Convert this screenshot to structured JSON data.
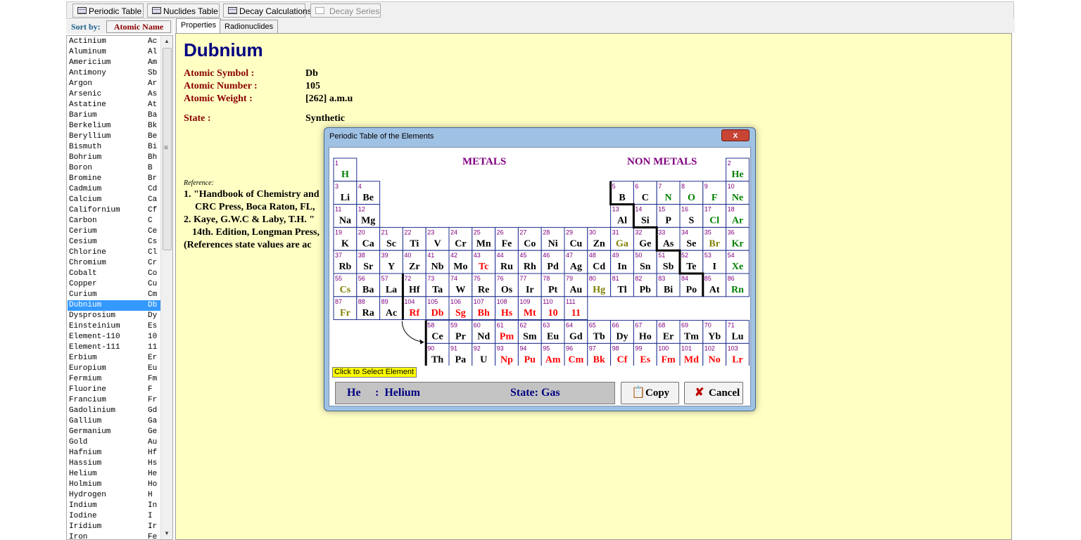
{
  "toolbar": {
    "buttons": [
      {
        "label": "Periodic Table",
        "enabled": true
      },
      {
        "label": "Nuclides Table",
        "enabled": true
      },
      {
        "label": "Decay Calculations",
        "enabled": true
      },
      {
        "label": "Decay Series",
        "enabled": false
      }
    ]
  },
  "sort": {
    "label": "Sort by:",
    "value": "Atomic Name"
  },
  "element_list": {
    "selected": "Dubnium",
    "items": [
      [
        "Actinium",
        "Ac"
      ],
      [
        "Aluminum",
        "Al"
      ],
      [
        "Americium",
        "Am"
      ],
      [
        "Antimony",
        "Sb"
      ],
      [
        "Argon",
        "Ar"
      ],
      [
        "Arsenic",
        "As"
      ],
      [
        "Astatine",
        "At"
      ],
      [
        "Barium",
        "Ba"
      ],
      [
        "Berkelium",
        "Bk"
      ],
      [
        "Beryllium",
        "Be"
      ],
      [
        "Bismuth",
        "Bi"
      ],
      [
        "Bohrium",
        "Bh"
      ],
      [
        "Boron",
        "B"
      ],
      [
        "Bromine",
        "Br"
      ],
      [
        "Cadmium",
        "Cd"
      ],
      [
        "Calcium",
        "Ca"
      ],
      [
        "Californium",
        "Cf"
      ],
      [
        "Carbon",
        "C"
      ],
      [
        "Cerium",
        "Ce"
      ],
      [
        "Cesium",
        "Cs"
      ],
      [
        "Chlorine",
        "Cl"
      ],
      [
        "Chromium",
        "Cr"
      ],
      [
        "Cobalt",
        "Co"
      ],
      [
        "Copper",
        "Cu"
      ],
      [
        "Curium",
        "Cm"
      ],
      [
        "Dubnium",
        "Db"
      ],
      [
        "Dysprosium",
        "Dy"
      ],
      [
        "Einsteinium",
        "Es"
      ],
      [
        "Element-110",
        "10"
      ],
      [
        "Element-111",
        "11"
      ],
      [
        "Erbium",
        "Er"
      ],
      [
        "Europium",
        "Eu"
      ],
      [
        "Fermium",
        "Fm"
      ],
      [
        "Fluorine",
        "F"
      ],
      [
        "Francium",
        "Fr"
      ],
      [
        "Gadolinium",
        "Gd"
      ],
      [
        "Gallium",
        "Ga"
      ],
      [
        "Germanium",
        "Ge"
      ],
      [
        "Gold",
        "Au"
      ],
      [
        "Hafnium",
        "Hf"
      ],
      [
        "Hassium",
        "Hs"
      ],
      [
        "Helium",
        "He"
      ],
      [
        "Holmium",
        "Ho"
      ],
      [
        "Hydrogen",
        "H"
      ],
      [
        "Indium",
        "In"
      ],
      [
        "Iodine",
        "I"
      ],
      [
        "Iridium",
        "Ir"
      ],
      [
        "Iron",
        "Fe"
      ]
    ]
  },
  "tabs": [
    {
      "label": "Properties",
      "active": true
    },
    {
      "label": "Radionuclides",
      "active": false
    }
  ],
  "properties": {
    "name": "Dubnium",
    "symbol_label": "Atomic Symbol :",
    "symbol": "Db",
    "number_label": "Atomic Number :",
    "number": "105",
    "weight_label": "Atomic Weight :",
    "weight": "[262]  a.m.u",
    "state_label": "State :",
    "state": "Synthetic",
    "reference_title": "Reference:",
    "references": [
      "1. \"Handbook of Chemistry and",
      "CRC Press, Boca Raton, FL,",
      "2. Kaye, G.W.C & Laby, T.H. \"",
      "14th. Edition, Longman Press,",
      "(References state values are ac"
    ]
  },
  "dialog": {
    "title": "Periodic Table of the Elements",
    "close": "x",
    "metals_label": "METALS",
    "nonmetals_label": "NON METALS",
    "click_hint": "Click to Select Element",
    "info_symbol": "He",
    "info_sep": ":",
    "info_name": "Helium",
    "info_state": "State:  Gas",
    "copy_label": "Copy",
    "cancel_label": "Cancel",
    "colors": {
      "solid": "#000000",
      "gas": "#008000",
      "liquid": "#808000",
      "synthetic": "#ff0000",
      "number": "#800080"
    },
    "elements": [
      {
        "n": "1",
        "s": "H",
        "c": "gas",
        "r": 0,
        "col": 0
      },
      {
        "n": "2",
        "s": "He",
        "c": "gas",
        "r": 0,
        "col": 17
      },
      {
        "n": "3",
        "s": "Li",
        "c": "solid",
        "r": 1,
        "col": 0
      },
      {
        "n": "4",
        "s": "Be",
        "c": "solid",
        "r": 1,
        "col": 1
      },
      {
        "n": "5",
        "s": "B",
        "c": "solid",
        "r": 1,
        "col": 12
      },
      {
        "n": "6",
        "s": "C",
        "c": "solid",
        "r": 1,
        "col": 13
      },
      {
        "n": "7",
        "s": "N",
        "c": "gas",
        "r": 1,
        "col": 14
      },
      {
        "n": "8",
        "s": "O",
        "c": "gas",
        "r": 1,
        "col": 15
      },
      {
        "n": "9",
        "s": "F",
        "c": "gas",
        "r": 1,
        "col": 16
      },
      {
        "n": "10",
        "s": "Ne",
        "c": "gas",
        "r": 1,
        "col": 17
      },
      {
        "n": "11",
        "s": "Na",
        "c": "solid",
        "r": 2,
        "col": 0
      },
      {
        "n": "12",
        "s": "Mg",
        "c": "solid",
        "r": 2,
        "col": 1
      },
      {
        "n": "13",
        "s": "Al",
        "c": "solid",
        "r": 2,
        "col": 12
      },
      {
        "n": "14",
        "s": "Si",
        "c": "solid",
        "r": 2,
        "col": 13
      },
      {
        "n": "15",
        "s": "P",
        "c": "solid",
        "r": 2,
        "col": 14
      },
      {
        "n": "16",
        "s": "S",
        "c": "solid",
        "r": 2,
        "col": 15
      },
      {
        "n": "17",
        "s": "Cl",
        "c": "gas",
        "r": 2,
        "col": 16
      },
      {
        "n": "18",
        "s": "Ar",
        "c": "gas",
        "r": 2,
        "col": 17
      },
      {
        "n": "19",
        "s": "K",
        "c": "solid",
        "r": 3,
        "col": 0
      },
      {
        "n": "20",
        "s": "Ca",
        "c": "solid",
        "r": 3,
        "col": 1
      },
      {
        "n": "21",
        "s": "Sc",
        "c": "solid",
        "r": 3,
        "col": 2
      },
      {
        "n": "22",
        "s": "Ti",
        "c": "solid",
        "r": 3,
        "col": 3
      },
      {
        "n": "23",
        "s": "V",
        "c": "solid",
        "r": 3,
        "col": 4
      },
      {
        "n": "24",
        "s": "Cr",
        "c": "solid",
        "r": 3,
        "col": 5
      },
      {
        "n": "25",
        "s": "Mn",
        "c": "solid",
        "r": 3,
        "col": 6
      },
      {
        "n": "26",
        "s": "Fe",
        "c": "solid",
        "r": 3,
        "col": 7
      },
      {
        "n": "27",
        "s": "Co",
        "c": "solid",
        "r": 3,
        "col": 8
      },
      {
        "n": "28",
        "s": "Ni",
        "c": "solid",
        "r": 3,
        "col": 9
      },
      {
        "n": "29",
        "s": "Cu",
        "c": "solid",
        "r": 3,
        "col": 10
      },
      {
        "n": "30",
        "s": "Zn",
        "c": "solid",
        "r": 3,
        "col": 11
      },
      {
        "n": "31",
        "s": "Ga",
        "c": "liquid",
        "r": 3,
        "col": 12
      },
      {
        "n": "32",
        "s": "Ge",
        "c": "solid",
        "r": 3,
        "col": 13
      },
      {
        "n": "33",
        "s": "As",
        "c": "solid",
        "r": 3,
        "col": 14
      },
      {
        "n": "34",
        "s": "Se",
        "c": "solid",
        "r": 3,
        "col": 15
      },
      {
        "n": "35",
        "s": "Br",
        "c": "liquid",
        "r": 3,
        "col": 16
      },
      {
        "n": "36",
        "s": "Kr",
        "c": "gas",
        "r": 3,
        "col": 17
      },
      {
        "n": "37",
        "s": "Rb",
        "c": "solid",
        "r": 4,
        "col": 0
      },
      {
        "n": "38",
        "s": "Sr",
        "c": "solid",
        "r": 4,
        "col": 1
      },
      {
        "n": "39",
        "s": "Y",
        "c": "solid",
        "r": 4,
        "col": 2
      },
      {
        "n": "40",
        "s": "Zr",
        "c": "solid",
        "r": 4,
        "col": 3
      },
      {
        "n": "41",
        "s": "Nb",
        "c": "solid",
        "r": 4,
        "col": 4
      },
      {
        "n": "42",
        "s": "Mo",
        "c": "solid",
        "r": 4,
        "col": 5
      },
      {
        "n": "43",
        "s": "Tc",
        "c": "synthetic",
        "r": 4,
        "col": 6
      },
      {
        "n": "44",
        "s": "Ru",
        "c": "solid",
        "r": 4,
        "col": 7
      },
      {
        "n": "45",
        "s": "Rh",
        "c": "solid",
        "r": 4,
        "col": 8
      },
      {
        "n": "46",
        "s": "Pd",
        "c": "solid",
        "r": 4,
        "col": 9
      },
      {
        "n": "47",
        "s": "Ag",
        "c": "solid",
        "r": 4,
        "col": 10
      },
      {
        "n": "48",
        "s": "Cd",
        "c": "solid",
        "r": 4,
        "col": 11
      },
      {
        "n": "49",
        "s": "In",
        "c": "solid",
        "r": 4,
        "col": 12
      },
      {
        "n": "50",
        "s": "Sn",
        "c": "solid",
        "r": 4,
        "col": 13
      },
      {
        "n": "51",
        "s": "Sb",
        "c": "solid",
        "r": 4,
        "col": 14
      },
      {
        "n": "52",
        "s": "Te",
        "c": "solid",
        "r": 4,
        "col": 15
      },
      {
        "n": "53",
        "s": "I",
        "c": "solid",
        "r": 4,
        "col": 16
      },
      {
        "n": "54",
        "s": "Xe",
        "c": "gas",
        "r": 4,
        "col": 17
      },
      {
        "n": "55",
        "s": "Cs",
        "c": "liquid",
        "r": 5,
        "col": 0
      },
      {
        "n": "56",
        "s": "Ba",
        "c": "solid",
        "r": 5,
        "col": 1
      },
      {
        "n": "57",
        "s": "La",
        "c": "solid",
        "r": 5,
        "col": 2
      },
      {
        "n": "72",
        "s": "Hf",
        "c": "solid",
        "r": 5,
        "col": 3
      },
      {
        "n": "73",
        "s": "Ta",
        "c": "solid",
        "r": 5,
        "col": 4
      },
      {
        "n": "74",
        "s": "W",
        "c": "solid",
        "r": 5,
        "col": 5
      },
      {
        "n": "75",
        "s": "Re",
        "c": "solid",
        "r": 5,
        "col": 6
      },
      {
        "n": "76",
        "s": "Os",
        "c": "solid",
        "r": 5,
        "col": 7
      },
      {
        "n": "77",
        "s": "Ir",
        "c": "solid",
        "r": 5,
        "col": 8
      },
      {
        "n": "78",
        "s": "Pt",
        "c": "solid",
        "r": 5,
        "col": 9
      },
      {
        "n": "79",
        "s": "Au",
        "c": "solid",
        "r": 5,
        "col": 10
      },
      {
        "n": "80",
        "s": "Hg",
        "c": "liquid",
        "r": 5,
        "col": 11
      },
      {
        "n": "81",
        "s": "Tl",
        "c": "solid",
        "r": 5,
        "col": 12
      },
      {
        "n": "82",
        "s": "Pb",
        "c": "solid",
        "r": 5,
        "col": 13
      },
      {
        "n": "83",
        "s": "Bi",
        "c": "solid",
        "r": 5,
        "col": 14
      },
      {
        "n": "84",
        "s": "Po",
        "c": "solid",
        "r": 5,
        "col": 15
      },
      {
        "n": "85",
        "s": "At",
        "c": "solid",
        "r": 5,
        "col": 16
      },
      {
        "n": "86",
        "s": "Rn",
        "c": "gas",
        "r": 5,
        "col": 17
      },
      {
        "n": "87",
        "s": "Fr",
        "c": "liquid",
        "r": 6,
        "col": 0
      },
      {
        "n": "88",
        "s": "Ra",
        "c": "solid",
        "r": 6,
        "col": 1
      },
      {
        "n": "89",
        "s": "Ac",
        "c": "solid",
        "r": 6,
        "col": 2
      },
      {
        "n": "104",
        "s": "Rf",
        "c": "synthetic",
        "r": 6,
        "col": 3
      },
      {
        "n": "105",
        "s": "Db",
        "c": "synthetic",
        "r": 6,
        "col": 4
      },
      {
        "n": "106",
        "s": "Sg",
        "c": "synthetic",
        "r": 6,
        "col": 5
      },
      {
        "n": "107",
        "s": "Bh",
        "c": "synthetic",
        "r": 6,
        "col": 6
      },
      {
        "n": "108",
        "s": "Hs",
        "c": "synthetic",
        "r": 6,
        "col": 7
      },
      {
        "n": "109",
        "s": "Mt",
        "c": "synthetic",
        "r": 6,
        "col": 8
      },
      {
        "n": "110",
        "s": "10",
        "c": "synthetic",
        "r": 6,
        "col": 9
      },
      {
        "n": "111",
        "s": "11",
        "c": "synthetic",
        "r": 6,
        "col": 10
      },
      {
        "n": "58",
        "s": "Ce",
        "c": "solid",
        "r": 7,
        "col": 4
      },
      {
        "n": "59",
        "s": "Pr",
        "c": "solid",
        "r": 7,
        "col": 5
      },
      {
        "n": "60",
        "s": "Nd",
        "c": "solid",
        "r": 7,
        "col": 6
      },
      {
        "n": "61",
        "s": "Pm",
        "c": "synthetic",
        "r": 7,
        "col": 7
      },
      {
        "n": "62",
        "s": "Sm",
        "c": "solid",
        "r": 7,
        "col": 8
      },
      {
        "n": "63",
        "s": "Eu",
        "c": "solid",
        "r": 7,
        "col": 9
      },
      {
        "n": "64",
        "s": "Gd",
        "c": "solid",
        "r": 7,
        "col": 10
      },
      {
        "n": "65",
        "s": "Tb",
        "c": "solid",
        "r": 7,
        "col": 11
      },
      {
        "n": "66",
        "s": "Dy",
        "c": "solid",
        "r": 7,
        "col": 12
      },
      {
        "n": "67",
        "s": "Ho",
        "c": "solid",
        "r": 7,
        "col": 13
      },
      {
        "n": "68",
        "s": "Er",
        "c": "solid",
        "r": 7,
        "col": 14
      },
      {
        "n": "69",
        "s": "Tm",
        "c": "solid",
        "r": 7,
        "col": 15
      },
      {
        "n": "70",
        "s": "Yb",
        "c": "solid",
        "r": 7,
        "col": 16
      },
      {
        "n": "71",
        "s": "Lu",
        "c": "solid",
        "r": 7,
        "col": 17
      },
      {
        "n": "90",
        "s": "Th",
        "c": "solid",
        "r": 8,
        "col": 4
      },
      {
        "n": "91",
        "s": "Pa",
        "c": "solid",
        "r": 8,
        "col": 5
      },
      {
        "n": "92",
        "s": "U",
        "c": "solid",
        "r": 8,
        "col": 6
      },
      {
        "n": "93",
        "s": "Np",
        "c": "synthetic",
        "r": 8,
        "col": 7
      },
      {
        "n": "94",
        "s": "Pu",
        "c": "synthetic",
        "r": 8,
        "col": 8
      },
      {
        "n": "95",
        "s": "Am",
        "c": "synthetic",
        "r": 8,
        "col": 9
      },
      {
        "n": "96",
        "s": "Cm",
        "c": "synthetic",
        "r": 8,
        "col": 10
      },
      {
        "n": "97",
        "s": "Bk",
        "c": "synthetic",
        "r": 8,
        "col": 11
      },
      {
        "n": "98",
        "s": "Cf",
        "c": "synthetic",
        "r": 8,
        "col": 12
      },
      {
        "n": "99",
        "s": "Es",
        "c": "synthetic",
        "r": 8,
        "col": 13
      },
      {
        "n": "100",
        "s": "Fm",
        "c": "synthetic",
        "r": 8,
        "col": 14
      },
      {
        "n": "101",
        "s": "Md",
        "c": "synthetic",
        "r": 8,
        "col": 15
      },
      {
        "n": "102",
        "s": "No",
        "c": "synthetic",
        "r": 8,
        "col": 16
      },
      {
        "n": "103",
        "s": "Lr",
        "c": "synthetic",
        "r": 8,
        "col": 17
      }
    ]
  }
}
